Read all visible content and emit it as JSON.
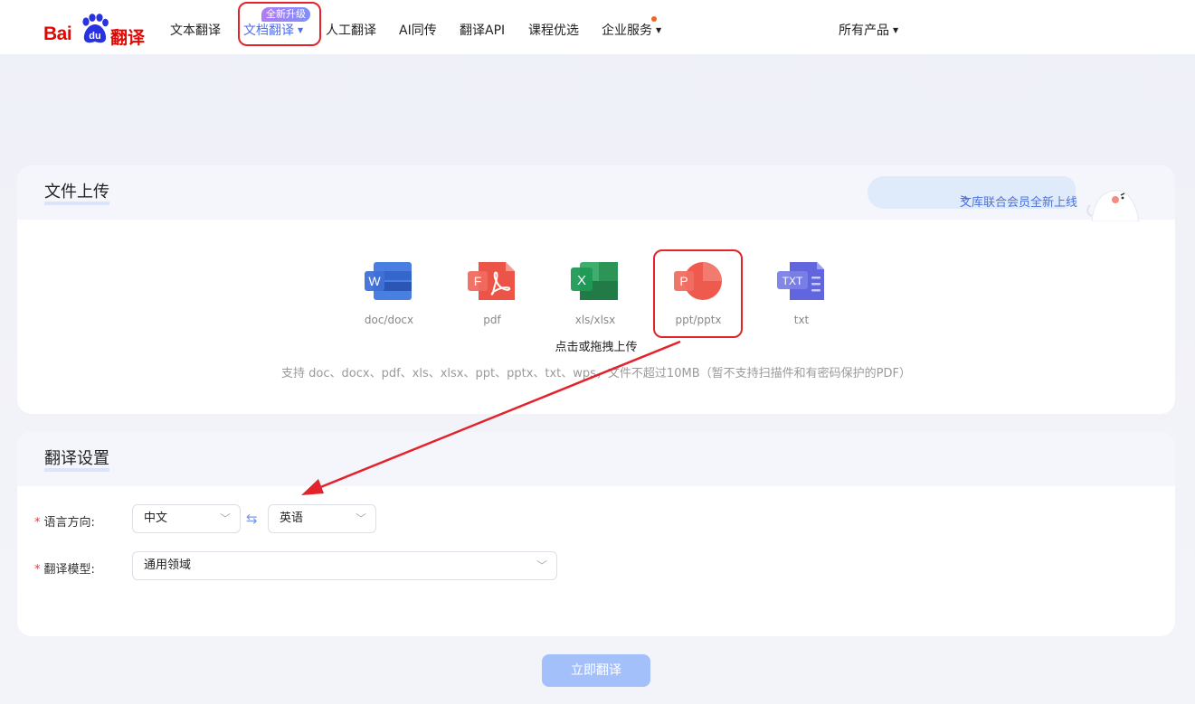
{
  "header": {
    "logo": {
      "text_bai": "Bai",
      "text_du": "du",
      "text_fy": "翻译"
    },
    "nav": [
      {
        "label": "文本翻译"
      },
      {
        "label": "文档翻译",
        "active": true,
        "badge": "全新升级"
      },
      {
        "label": "人工翻译"
      },
      {
        "label": "AI同传"
      },
      {
        "label": "翻译API"
      },
      {
        "label": "课程优选"
      },
      {
        "label": "企业服务",
        "has_dot": true
      },
      {
        "label": "所有产品"
      }
    ]
  },
  "upload": {
    "title": "文件上传",
    "vip_banner": "文库联合会员全新上线",
    "file_types": [
      {
        "label": "doc/docx",
        "icon": "word-icon",
        "letter": "W",
        "color": "#3b6fd6"
      },
      {
        "label": "pdf",
        "icon": "pdf-icon",
        "letter": "F",
        "color": "#e8473f"
      },
      {
        "label": "xls/xlsx",
        "icon": "excel-icon",
        "letter": "X",
        "color": "#1f8f4e"
      },
      {
        "label": "ppt/pptx",
        "icon": "ppt-icon",
        "letter": "P",
        "color": "#e84a3c"
      },
      {
        "label": "txt",
        "icon": "txt-icon",
        "letter": "TXT",
        "color": "#5a5fd8"
      }
    ],
    "tip": "点击或拖拽上传",
    "description": "支持 doc、docx、pdf、xls、xlsx、ppt、pptx、txt、wps，文件不超过10MB（暂不支持扫描件和有密码保护的PDF）"
  },
  "settings": {
    "title": "翻译设置",
    "language_label": "语言方向:",
    "source_lang": "中文",
    "target_lang": "英语",
    "model_label": "翻译模型:",
    "model_value": "通用领域"
  },
  "actions": {
    "translate": "立即翻译"
  },
  "colors": {
    "brand_red": "#e10602",
    "accent_blue": "#4e6ef2",
    "annotation_red": "#e3232c"
  }
}
